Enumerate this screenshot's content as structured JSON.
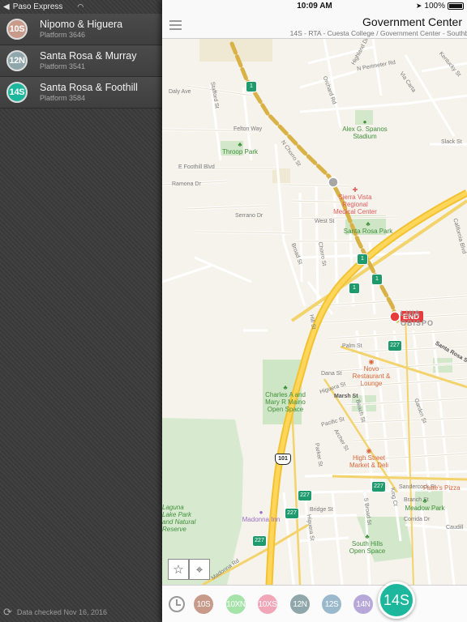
{
  "side_status": {
    "back_app": "Paso Express"
  },
  "stops": [
    {
      "route": "10S",
      "color": "#c79a8a",
      "name": "Nipomo & Higuera",
      "platform": "Platform 3646"
    },
    {
      "route": "12N",
      "color": "#8fa6ab",
      "name": "Santa Rosa & Murray",
      "platform": "Platform 3541"
    },
    {
      "route": "14S",
      "color": "#1cb79c",
      "name": "Santa Rosa & Foothill",
      "platform": "Platform 3584"
    }
  ],
  "side_footer": {
    "text": "Data checked Nov 16, 2016"
  },
  "status": {
    "time": "10:09 AM",
    "battery": "100%"
  },
  "nav": {
    "title": "Government Center",
    "subtitle": "14S - RTA - Cuesta College / Government Center - Southb"
  },
  "map": {
    "streets": {
      "highland": "Highland Dr",
      "perimeter": "N Perimeter Rd",
      "orchard": "Orchard Rd",
      "via_carta": "Via Carta",
      "kentucky": "Kentucky St",
      "daly": "Daly Ave",
      "stafford": "Stafford St",
      "felton": "Felton Way",
      "foothill": "E Foothill Blvd",
      "chorro_n": "N Chorro St",
      "ramona": "Ramona Dr",
      "serrano": "Serrano Dr",
      "slack": "Slack St",
      "west": "West St",
      "broad": "Broad St",
      "chorro": "Chorro St",
      "california": "California Blvd",
      "hill": "Hill St",
      "palm": "Palm St",
      "dana": "Dana St",
      "higuera": "Higuera St",
      "marsh": "Marsh St",
      "pacific": "Pacific St",
      "archer": "Archer St",
      "broad2": "Broad St",
      "parker": "Parker St",
      "bridge": "Bridge St",
      "sandercock": "Sandercock St",
      "branch": "Branch St",
      "king": "King Ct",
      "corrida": "Corrida Dr",
      "caudill": "Caudill",
      "madonna": "Madonna Rd",
      "santa_rosa": "Santa Rosa St",
      "garden": "Garden St",
      "broad3": "Broad St",
      "beach": "Beach St",
      "higuera2": "Higuera St",
      "broad_s": "S Broad St"
    },
    "places": {
      "stadium": "Alex G. Spanos Stadium",
      "throop": "Throop Park",
      "medical": "Sierra Vista Regional Medical Center",
      "santa_rosa_park": "Santa Rosa Park",
      "novo": "Novo Restaurant & Lounge",
      "maino": "Charles A and Mary R Maino Open Space",
      "high_street": "High Street Market & Deli",
      "fattes": "Fatte's Pizza",
      "meadow": "Meadow Park",
      "madonna_inn": "Madonna Inn",
      "south_hills": "South Hills Open Space",
      "laguna": "Laguna Lake Park and Natural Reserve",
      "city": "LUIS OBISPO"
    },
    "shields": {
      "hwy1": "1",
      "hwy227": "227",
      "hwy101": "101"
    },
    "end_marker": "END",
    "route_color": "#e4b84a"
  },
  "routes": [
    {
      "label": "10S",
      "color": "#c79a8a"
    },
    {
      "label": "10XN",
      "color": "#a6e3a9"
    },
    {
      "label": "10XS",
      "color": "#f2a7b8"
    },
    {
      "label": "12N",
      "color": "#8fa6ab"
    },
    {
      "label": "12S",
      "color": "#9bb9cc"
    },
    {
      "label": "14N",
      "color": "#b7a8d9"
    },
    {
      "label": "14S",
      "color": "#1cb79c"
    }
  ]
}
